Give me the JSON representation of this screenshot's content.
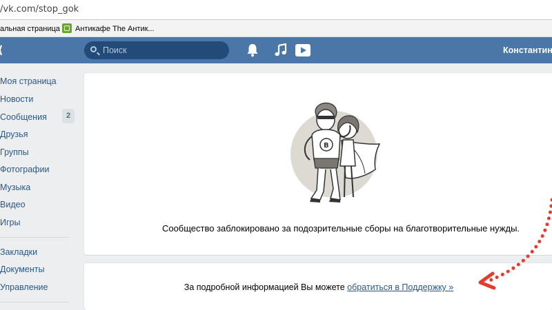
{
  "browser": {
    "url": "/vk.com/stop_gok",
    "bookmarks": [
      {
        "label": "альная страница"
      },
      {
        "label": "Антикафе The Антик..."
      }
    ]
  },
  "header": {
    "search_placeholder": "Поиск",
    "user_name": "Константин",
    "icons": [
      "bell-icon",
      "music-note-icon",
      "video-play-icon"
    ]
  },
  "sidebar": {
    "items": [
      {
        "label": "Моя страница"
      },
      {
        "label": "Новости"
      },
      {
        "label": "Сообщения",
        "badge": "2"
      },
      {
        "label": "Друзья"
      },
      {
        "label": "Группы"
      },
      {
        "label": "Фотографии"
      },
      {
        "label": "Музыка"
      },
      {
        "label": "Видео"
      },
      {
        "label": "Игры"
      }
    ],
    "secondary": [
      {
        "label": "Закладки"
      },
      {
        "label": "Документы"
      },
      {
        "label": "Управление"
      }
    ]
  },
  "main": {
    "blocked_message": "Сообщество заблокировано за подозрительные сборы на благотворительные нужды.",
    "info_prefix": "За подробной информацией Вы можете ",
    "support_link": "обратиться в Поддержку »"
  },
  "colors": {
    "header_bg": "#4a76a8",
    "link": "#2a5885",
    "page_bg": "#edeef0",
    "annotation_arrow": "#e53b2f"
  }
}
